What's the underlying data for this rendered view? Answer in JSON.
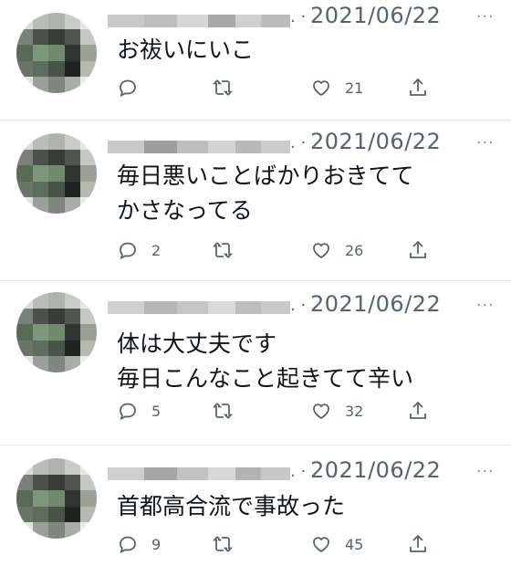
{
  "tweets": [
    {
      "dot": ". ·",
      "date": "2021/06/22",
      "more": "···",
      "text": "お祓いにいこ",
      "reply_count": "",
      "like_count": "21"
    },
    {
      "dot": ". ·",
      "date": "2021/06/22",
      "more": "···",
      "text": "毎日悪いことばかりおきてて\nかさなってる",
      "reply_count": "2",
      "like_count": "26"
    },
    {
      "dot": ". ·",
      "date": "2021/06/22",
      "more": "···",
      "text": "体は大丈夫です\n毎日こんなこと起きてて辛い",
      "reply_count": "5",
      "like_count": "32"
    },
    {
      "dot": ". ·",
      "date": "2021/06/22",
      "more": "···",
      "text": "首都高合流で事故った",
      "reply_count": "9",
      "like_count": "45"
    }
  ],
  "icons": {
    "reply": "reply-icon",
    "retweet": "retweet-icon",
    "like": "heart-icon",
    "share": "share-icon"
  },
  "colors": {
    "muted": "#536471",
    "separator": "#e6e9eb"
  }
}
